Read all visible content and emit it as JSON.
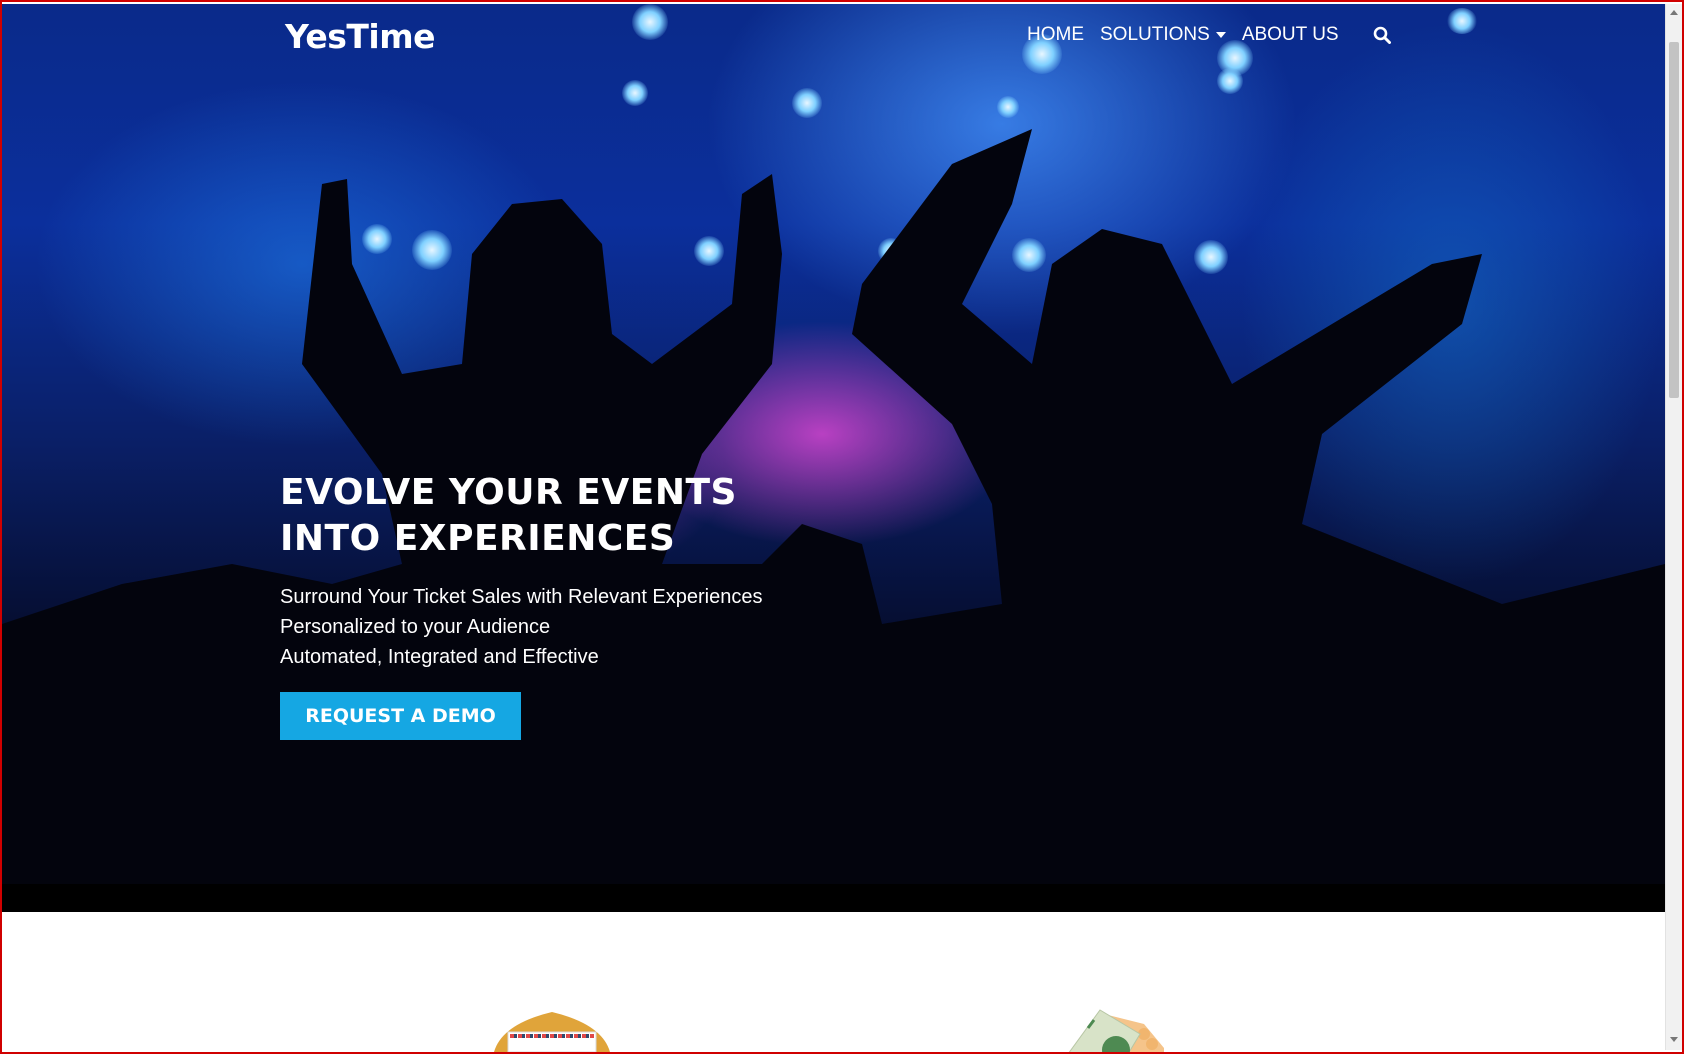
{
  "nav": {
    "logo_text": "YesTime",
    "links": [
      {
        "label": "HOME"
      },
      {
        "label": "SOLUTIONS",
        "has_dropdown": true
      },
      {
        "label": "ABOUT US"
      }
    ],
    "search_icon": "search-icon"
  },
  "hero": {
    "headline_line1": "EVOLVE YOUR EVENTS",
    "headline_line2": "INTO EXPERIENCES",
    "subline1": "Surround Your Ticket Sales with Relevant Experiences",
    "subline2": "Personalized to your Audience",
    "subline3": "Automated, Integrated and Effective",
    "cta_label": "REQUEST A DEMO"
  },
  "features": {
    "icons": [
      "envelope-icon",
      "money-icon"
    ]
  },
  "colors": {
    "accent": "#15a7e3",
    "hero_text": "#ffffff",
    "frame": "#d00000"
  }
}
